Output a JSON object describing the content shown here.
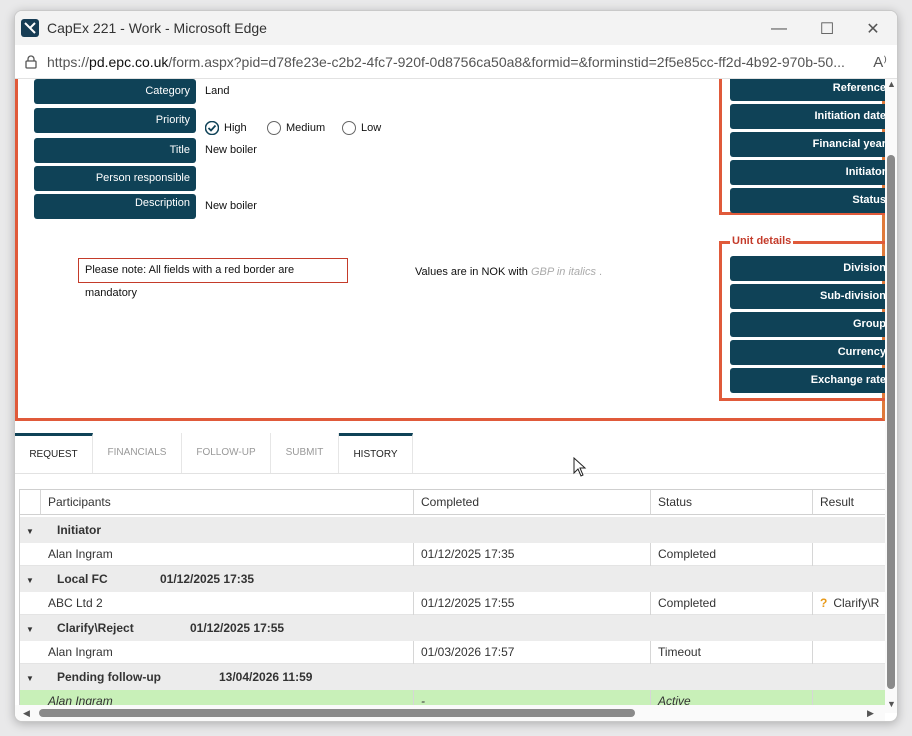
{
  "window": {
    "title": "CapEx 221 - Work - Microsoft Edge",
    "minimize": "—",
    "maximize": "☐",
    "close": "✕"
  },
  "address": {
    "url_prefix": "https://",
    "url_host": "pd.epc.co.uk",
    "url_path": "/form.aspx?pid=d78fe23e-c2b2-4fc7-920f-0d8756ca50a8&formid=&forminstid=2f5e85cc-ff2d-4b92-970b-50..."
  },
  "form": {
    "fields": [
      {
        "label": "Category",
        "value": "Land"
      },
      {
        "label": "Priority",
        "value": ""
      },
      {
        "label": "Title",
        "value": "New boiler"
      },
      {
        "label": "Person responsible",
        "value": ""
      },
      {
        "label": "Description",
        "value": "New boiler"
      }
    ],
    "priority_options": [
      {
        "label": "High",
        "checked": true
      },
      {
        "label": "Medium",
        "checked": false
      },
      {
        "label": "Low",
        "checked": false
      }
    ],
    "mandatory_note": "Please note: All fields with a red border are mandatory",
    "values_note_prefix": "Values are in NOK  with ",
    "values_note_italic": "GBP in italics",
    "values_note_suffix": " ."
  },
  "side": {
    "top_buttons": [
      "Reference",
      "Initiation date",
      "Financial year",
      "Initiator",
      "Status"
    ],
    "unit_legend": "Unit details",
    "unit_buttons": [
      "Division",
      "Sub-division",
      "Group",
      "Currency",
      "Exchange rate"
    ]
  },
  "tabs": [
    {
      "label": "REQUEST",
      "active": true
    },
    {
      "label": "FINANCIALS",
      "active": false
    },
    {
      "label": "FOLLOW-UP",
      "active": false
    },
    {
      "label": "SUBMIT",
      "active": false
    },
    {
      "label": "HISTORY",
      "active": true
    }
  ],
  "grid": {
    "headers": [
      "Participants",
      "Completed",
      "Status",
      "Result"
    ],
    "groups": [
      {
        "name": "Initiator",
        "date": "",
        "rows": [
          {
            "participant": "Alan Ingram",
            "completed": "01/12/2025 17:35",
            "status": "Completed",
            "result": ""
          }
        ]
      },
      {
        "name": "Local FC",
        "date": "01/12/2025 17:35",
        "rows": [
          {
            "participant": "ABC Ltd 2",
            "completed": "01/12/2025 17:55",
            "status": "Completed",
            "result": "Clarify\\R"
          }
        ]
      },
      {
        "name": "Clarify\\Reject",
        "date": "01/12/2025 17:55",
        "rows": [
          {
            "participant": "Alan Ingram",
            "completed": "01/03/2026 17:57",
            "status": "Timeout",
            "result": ""
          }
        ]
      },
      {
        "name": "Pending follow-up",
        "date": "13/04/2026 11:59",
        "rows": [
          {
            "participant": "Alan Ingram",
            "completed": "-",
            "status": "Active",
            "result": ""
          }
        ]
      }
    ]
  },
  "colors": {
    "label_bg": "#0f4257",
    "mandatory_border": "#c43b2a",
    "active_row": "#c8f0b8"
  }
}
